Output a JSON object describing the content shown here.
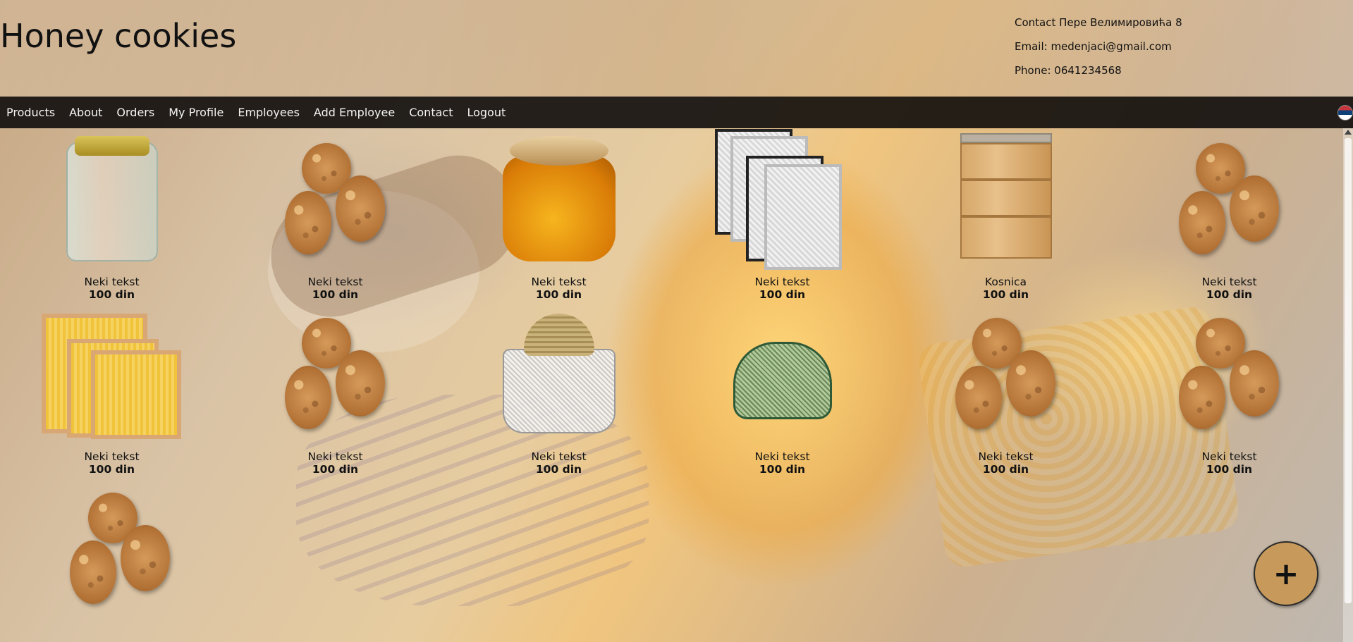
{
  "header": {
    "site_title": "Honey cookies",
    "contact_line": "Contact Пере Велимировића 8",
    "email_line": "Email: medenjaci@gmail.com",
    "phone_line": "Phone: 0641234568"
  },
  "nav": {
    "items": [
      "Products",
      "About",
      "Orders",
      "My Profile",
      "Employees",
      "Add Employee",
      "Contact",
      "Logout"
    ],
    "language_flag": "serbian-flag-icon"
  },
  "products": [
    {
      "name": "Neki tekst",
      "price": "100 din",
      "image": "empty-glass-jar"
    },
    {
      "name": "Neki tekst",
      "price": "100 din",
      "image": "honey-cookies"
    },
    {
      "name": "Neki tekst",
      "price": "100 din",
      "image": "honey-jar"
    },
    {
      "name": "Neki tekst",
      "price": "100 din",
      "image": "hive-frames-dark"
    },
    {
      "name": "Kosnica",
      "price": "100 din",
      "image": "beehive"
    },
    {
      "name": "Neki tekst",
      "price": "100 din",
      "image": "honey-cookies"
    },
    {
      "name": "Neki tekst",
      "price": "100 din",
      "image": "hive-frames-yellow"
    },
    {
      "name": "Neki tekst",
      "price": "100 din",
      "image": "honey-cookies"
    },
    {
      "name": "Neki tekst",
      "price": "100 din",
      "image": "beekeeper-veil-white"
    },
    {
      "name": "Neki tekst",
      "price": "100 din",
      "image": "beekeeper-veil-green"
    },
    {
      "name": "Neki tekst",
      "price": "100 din",
      "image": "honey-cookies"
    },
    {
      "name": "Neki tekst",
      "price": "100 din",
      "image": "honey-cookies"
    },
    {
      "name": "",
      "price": "",
      "image": "honey-cookies"
    }
  ],
  "fab": {
    "label": "+",
    "icon": "plus-icon"
  }
}
